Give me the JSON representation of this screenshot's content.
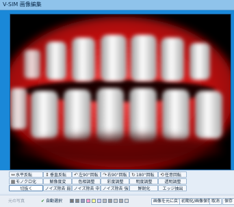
{
  "window": {
    "title": "V-SIM  画像編集"
  },
  "toolbar": {
    "row1": [
      {
        "icon": "⇔",
        "label": "水平反転"
      },
      {
        "icon": "⇕",
        "label": "垂直反転"
      },
      {
        "icon": "↶",
        "label": "左90°回転"
      },
      {
        "icon": "↷",
        "label": "右90°回転"
      },
      {
        "icon": "↻",
        "label": "180°回転"
      },
      {
        "icon": "⟲",
        "label": "任意回転"
      }
    ],
    "row2": [
      {
        "icon": "▦",
        "label": "モノクロ化"
      },
      {
        "icon": "",
        "label": "解像度変"
      },
      {
        "icon": "",
        "label": "色相調整"
      },
      {
        "icon": "",
        "label": "彩度調整"
      },
      {
        "icon": "",
        "label": "明度調整"
      },
      {
        "icon": "",
        "label": "透明調整"
      }
    ],
    "row3": [
      {
        "icon": "",
        "label": "切抜く"
      },
      {
        "icon": "",
        "label": "ノイズ除去 弱"
      },
      {
        "icon": "",
        "label": "ノイズ除去 中"
      },
      {
        "icon": "",
        "label": "ノイズ除去 強"
      },
      {
        "icon": "",
        "label": "鮮鋭化"
      },
      {
        "icon": "",
        "label": "エッジ抽出"
      }
    ]
  },
  "status": {
    "left_label": "元の写真",
    "check_label": "自動選択",
    "swatches": [
      "#777777",
      "#888888",
      "#9999bb",
      "#ff99cc",
      "#ffff99",
      "#ccccff",
      "#bbbbbb",
      "#999999",
      "#cccccc",
      "#aaaaaa",
      "#dddddd"
    ],
    "btn_undo": "画像を元に戻す",
    "btn_reset": "初期化/画像保存",
    "btn_cancel": "取消",
    "btn_ok": "保存"
  }
}
